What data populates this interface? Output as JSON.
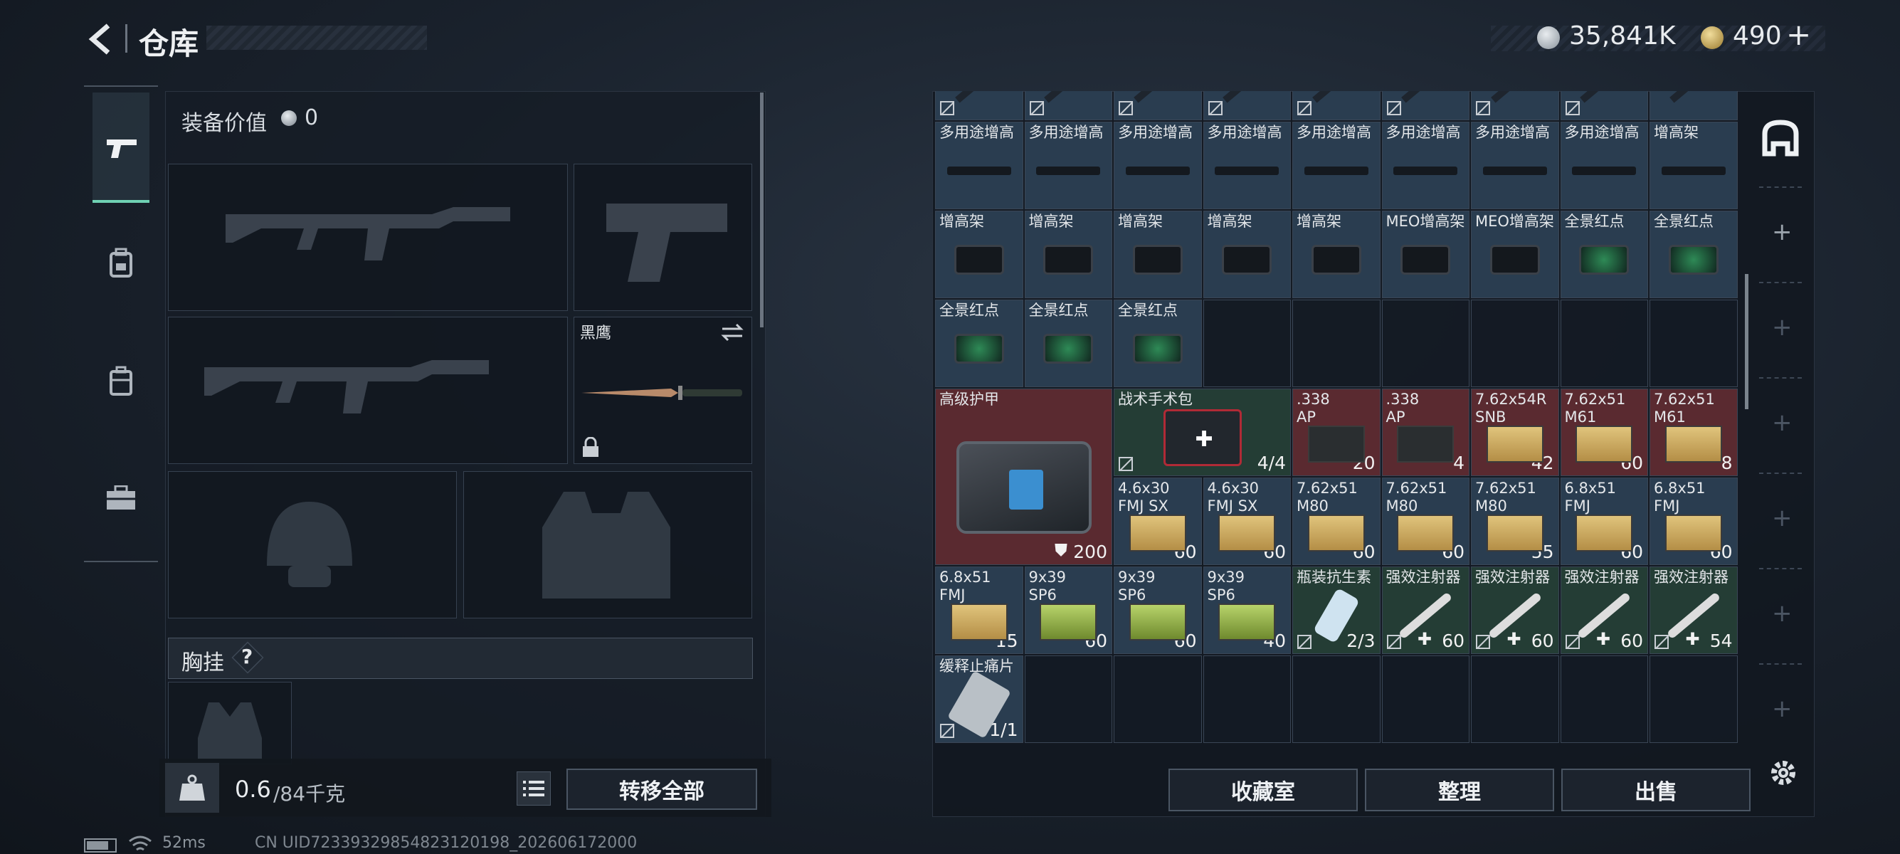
{
  "header": {
    "title": "仓库",
    "currency1": "35,841K",
    "currency2": "490",
    "add_label": "+"
  },
  "equipment": {
    "value_label": "装备价值",
    "value": "0",
    "knife_name": "黑鹰",
    "chest_label": "胸挂",
    "help": "?"
  },
  "weight": {
    "current": "0.6",
    "max": "/84千克"
  },
  "buttons": {
    "transfer_all": "转移全部",
    "collection": "收藏室",
    "sort": "整理",
    "sell": "出售"
  },
  "status": {
    "ping": "52ms",
    "uid": "CN UID72339329854823120198_202606172000"
  },
  "grid": {
    "row0": [
      "",
      "",
      "",
      "",
      "",
      "",
      "",
      "",
      ""
    ],
    "row1": [
      "多用途增高",
      "多用途增高",
      "多用途增高",
      "多用途增高",
      "多用途增高",
      "多用途增高",
      "多用途增高",
      "多用途增高",
      "增高架"
    ],
    "row2": [
      "增高架",
      "增高架",
      "增高架",
      "增高架",
      "增高架",
      "MEO增高架",
      "MEO增高架",
      "全景红点",
      "全景红点"
    ],
    "row3": [
      "全景红点",
      "全景红点",
      "全景红点"
    ],
    "armor": {
      "name": "高级护甲",
      "count": "200"
    },
    "medkit": {
      "name": "战术手术包",
      "count": "4/4"
    },
    "ammo_r4": [
      {
        "name": ".338\nAP",
        "count": "20"
      },
      {
        "name": ".338\nAP",
        "count": "4"
      },
      {
        "name": "7.62x54R\nSNB",
        "count": "42"
      },
      {
        "name": "7.62x51\nM61",
        "count": "60"
      },
      {
        "name": "7.62x51\nM61",
        "count": "8"
      }
    ],
    "ammo_r5": [
      {
        "name": "4.6x30\nFMJ SX",
        "count": "60"
      },
      {
        "name": "4.6x30\nFMJ SX",
        "count": "60"
      },
      {
        "name": "7.62x51\nM80",
        "count": "60"
      },
      {
        "name": "7.62x51\nM80",
        "count": "60"
      },
      {
        "name": "7.62x51\nM80",
        "count": "55"
      },
      {
        "name": "6.8x51\nFMJ",
        "count": "60"
      },
      {
        "name": "6.8x51\nFMJ",
        "count": "60"
      }
    ],
    "row6": [
      {
        "name": "6.8x51\nFMJ",
        "count": "15"
      },
      {
        "name": "9x39\nSP6",
        "count": "60"
      },
      {
        "name": "9x39\nSP6",
        "count": "60"
      },
      {
        "name": "9x39\nSP6",
        "count": "40"
      },
      {
        "name": "瓶装抗生素",
        "count": "2/3"
      },
      {
        "name": "强效注射器",
        "count": "60"
      },
      {
        "name": "强效注射器",
        "count": "60"
      },
      {
        "name": "强效注射器",
        "count": "60"
      },
      {
        "name": "强效注射器",
        "count": "54"
      }
    ],
    "row7": [
      {
        "name": "缓释止痛片",
        "count": "1/1"
      }
    ]
  }
}
